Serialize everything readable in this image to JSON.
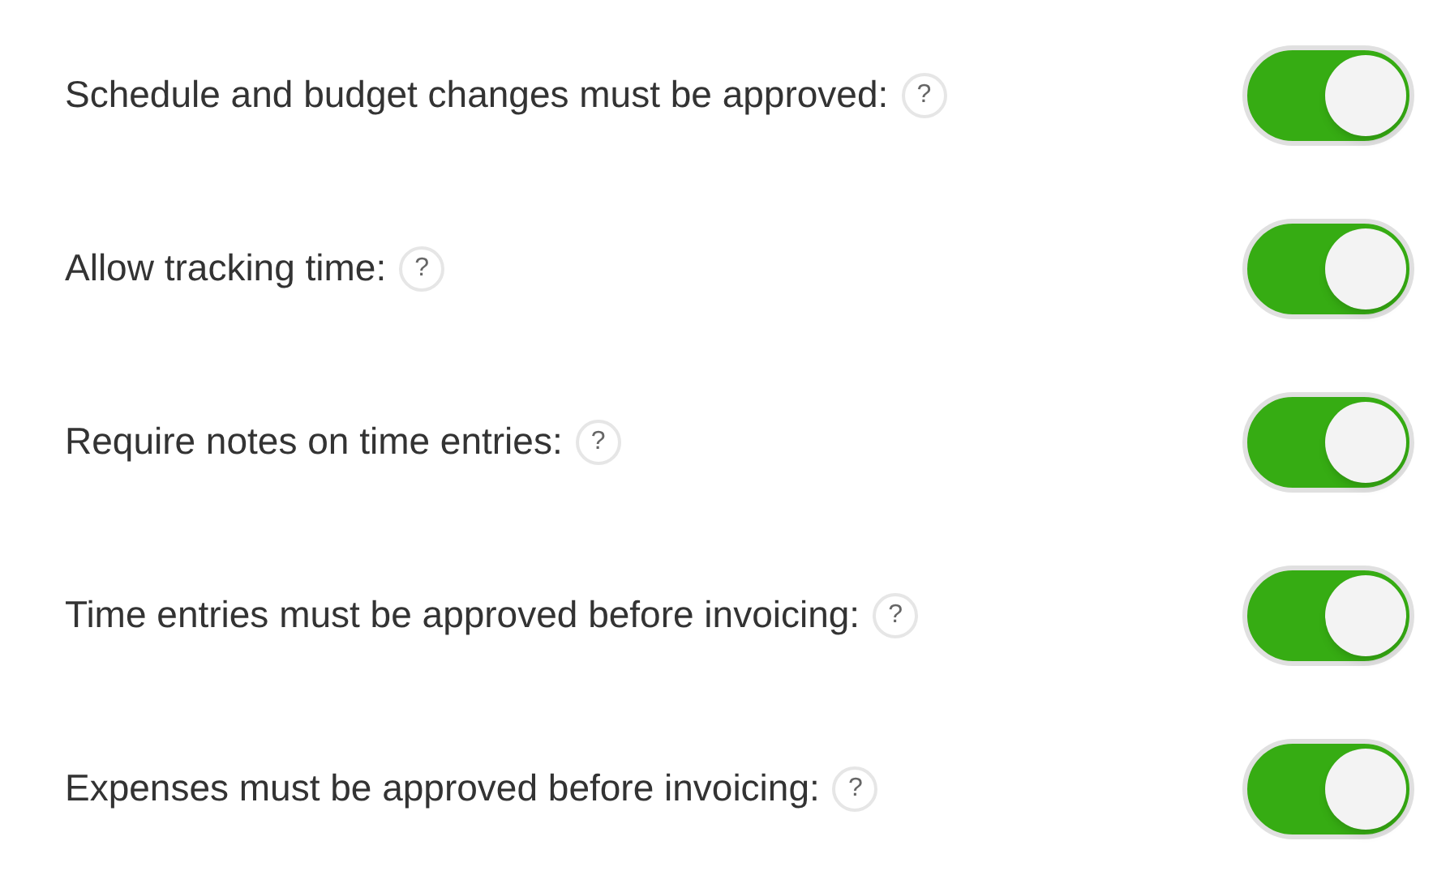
{
  "settings": [
    {
      "label": "Schedule and budget changes must be approved:",
      "help": "?",
      "on": true
    },
    {
      "label": "Allow tracking time:",
      "help": "?",
      "on": true
    },
    {
      "label": "Require notes on time entries:",
      "help": "?",
      "on": true
    },
    {
      "label": "Time entries must be approved before invoicing:",
      "help": "?",
      "on": true
    },
    {
      "label": "Expenses must be approved before invoicing:",
      "help": "?",
      "on": true
    }
  ]
}
